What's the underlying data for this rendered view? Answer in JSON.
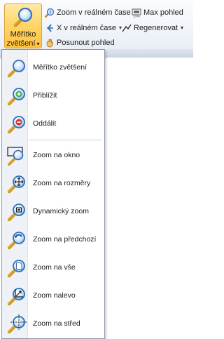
{
  "ribbon": {
    "zoom_button": {
      "line1": "Měřítko",
      "line2": "zvětšení",
      "arrow": "▾",
      "icon": "magnifier-zoom-icon"
    },
    "realtime_zoom": {
      "label": "Zoom v reálném čase",
      "arrow": "▾",
      "icon": "zoom-realtime-icon"
    },
    "realtime_x": {
      "label": "X v reálném čase",
      "arrow": "▾",
      "icon": "x-realtime-icon"
    },
    "pan": {
      "label": "Posunout pohled",
      "icon": "pan-hand-icon"
    },
    "max_view": {
      "label": "Max pohled",
      "icon": "max-view-icon"
    },
    "regenerate": {
      "label": "Regenerovat",
      "arrow": "▾",
      "icon": "regenerate-icon"
    }
  },
  "menu": {
    "items": [
      {
        "label": "Měřítko zvětšení",
        "icon": "magnifier-icon"
      },
      {
        "label": "Přiblížit",
        "icon": "zoom-in-icon"
      },
      {
        "label": "Oddálit",
        "icon": "zoom-out-icon"
      },
      {
        "label": "Zoom na okno",
        "icon": "zoom-window-icon"
      },
      {
        "label": "Zoom na rozměry",
        "icon": "zoom-extents-icon"
      },
      {
        "label": "Dynamický zoom",
        "icon": "zoom-dynamic-icon"
      },
      {
        "label": "Zoom na předchozí",
        "icon": "zoom-previous-icon"
      },
      {
        "label": "Zoom na vše",
        "icon": "zoom-all-icon"
      },
      {
        "label": "Zoom nalevo",
        "icon": "zoom-left-icon"
      },
      {
        "label": "Zoom na střed",
        "icon": "zoom-center-icon"
      }
    ]
  },
  "colors": {
    "accent": "#ffc23e",
    "lens": "#2f7fd0",
    "handle": "#d59a1e"
  }
}
